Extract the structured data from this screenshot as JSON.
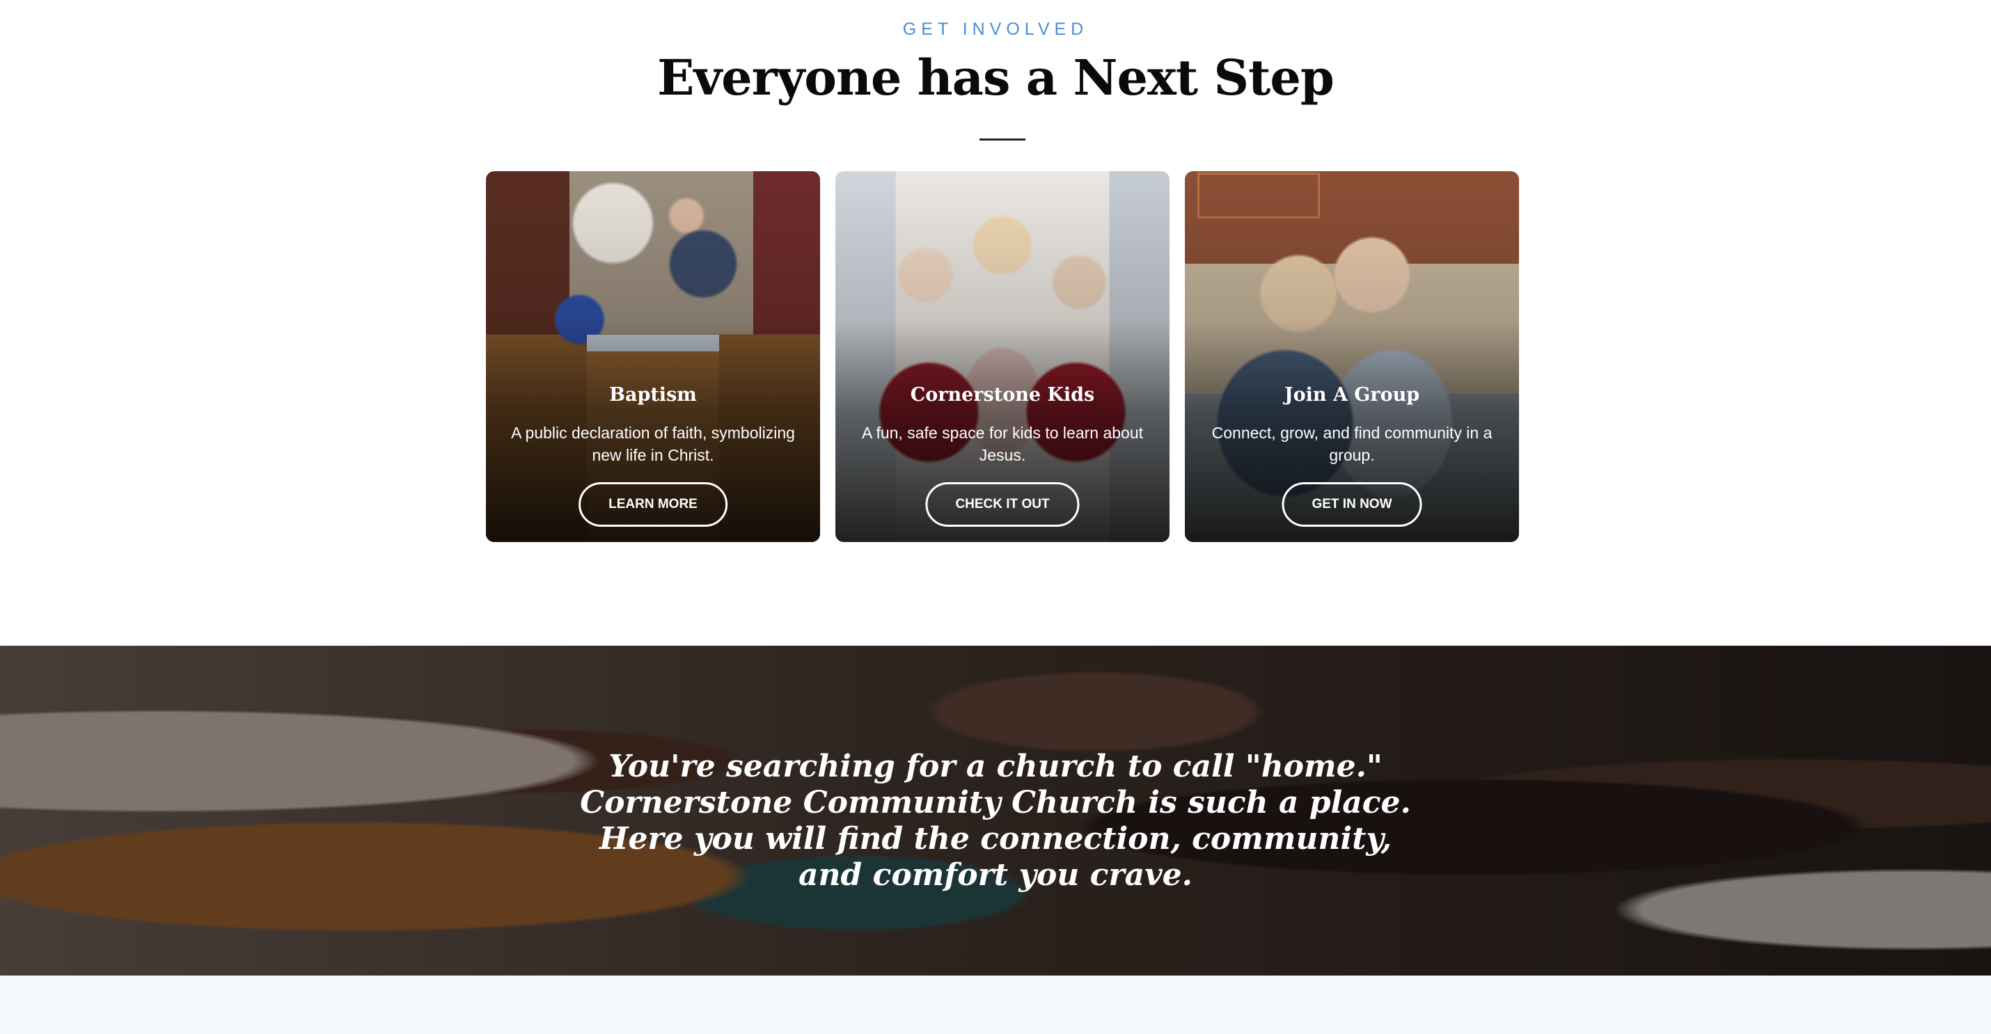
{
  "section": {
    "eyebrow": "GET INVOLVED",
    "heading": "Everyone has a Next Step"
  },
  "cards": [
    {
      "title": "Baptism",
      "text": "A public declaration of faith, symbolizing new life in Christ.",
      "button": "LEARN MORE"
    },
    {
      "title": "Cornerstone Kids",
      "text": "A fun, safe space for kids to learn about Jesus.",
      "button": "CHECK IT OUT"
    },
    {
      "title": "Join A Group",
      "text": "Connect, grow, and find community in a group.",
      "button": "GET IN NOW"
    }
  ],
  "banner": {
    "quote": "You're searching for a church to call \"home.\" Cornerstone Community Church is such a place. Here you will find the connection, community, and comfort you crave."
  },
  "colors": {
    "accent": "#4a8fd6",
    "bottom_strip": "#f4f9fb"
  }
}
